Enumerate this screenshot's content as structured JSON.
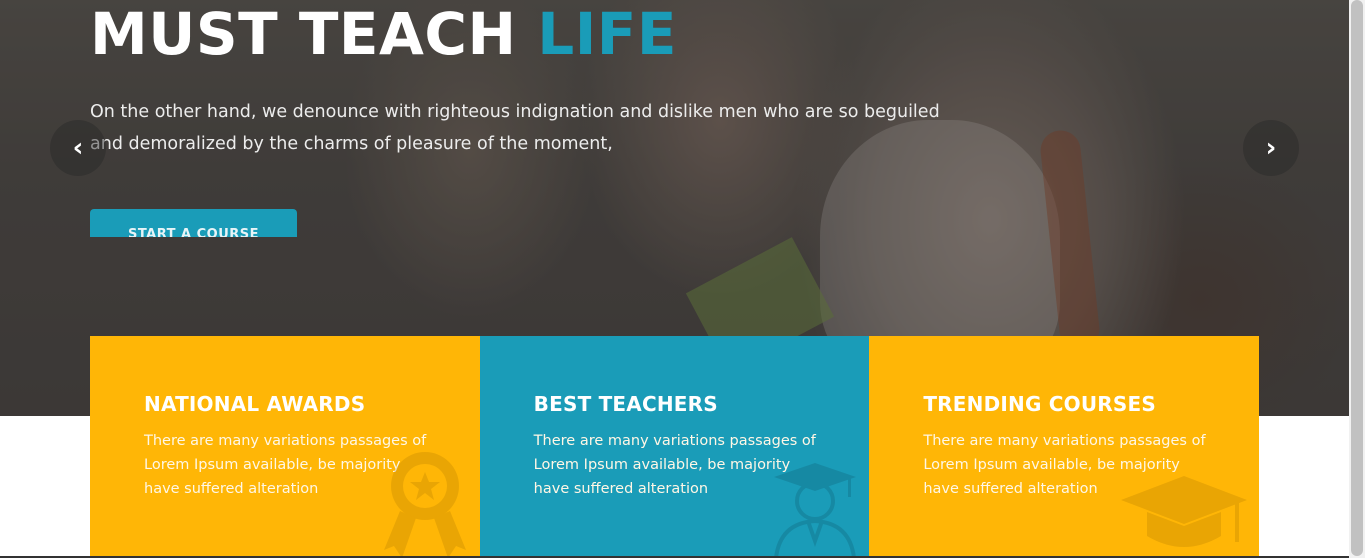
{
  "hero": {
    "title_main": "MUST TEACH",
    "title_accent": "LIFE",
    "subtitle": "On the other hand, we denounce with righteous indignation and dislike men who are so beguiled and demoralized by the charms of pleasure of the moment,",
    "cta_label": "START A COURSE",
    "prev_glyph": "‹",
    "next_glyph": "›"
  },
  "features": [
    {
      "title": "NATIONAL AWARDS",
      "text": "There are many variations passages of Lorem Ipsum available, be majority have suffered alteration",
      "icon": "award-icon",
      "color": "#ffb606"
    },
    {
      "title": "BEST TEACHERS",
      "text": "There are many variations passages of Lorem Ipsum available, be majority have suffered alteration",
      "icon": "teacher-icon",
      "color": "#1a9cb8"
    },
    {
      "title": "TRENDING COURSES",
      "text": "There are many variations passages of Lorem Ipsum available, be majority have suffered alteration",
      "icon": "graduation-cap-icon",
      "color": "#ffb606"
    }
  ],
  "colors": {
    "accent": "#1a9cb8",
    "yellow": "#ffb606"
  }
}
